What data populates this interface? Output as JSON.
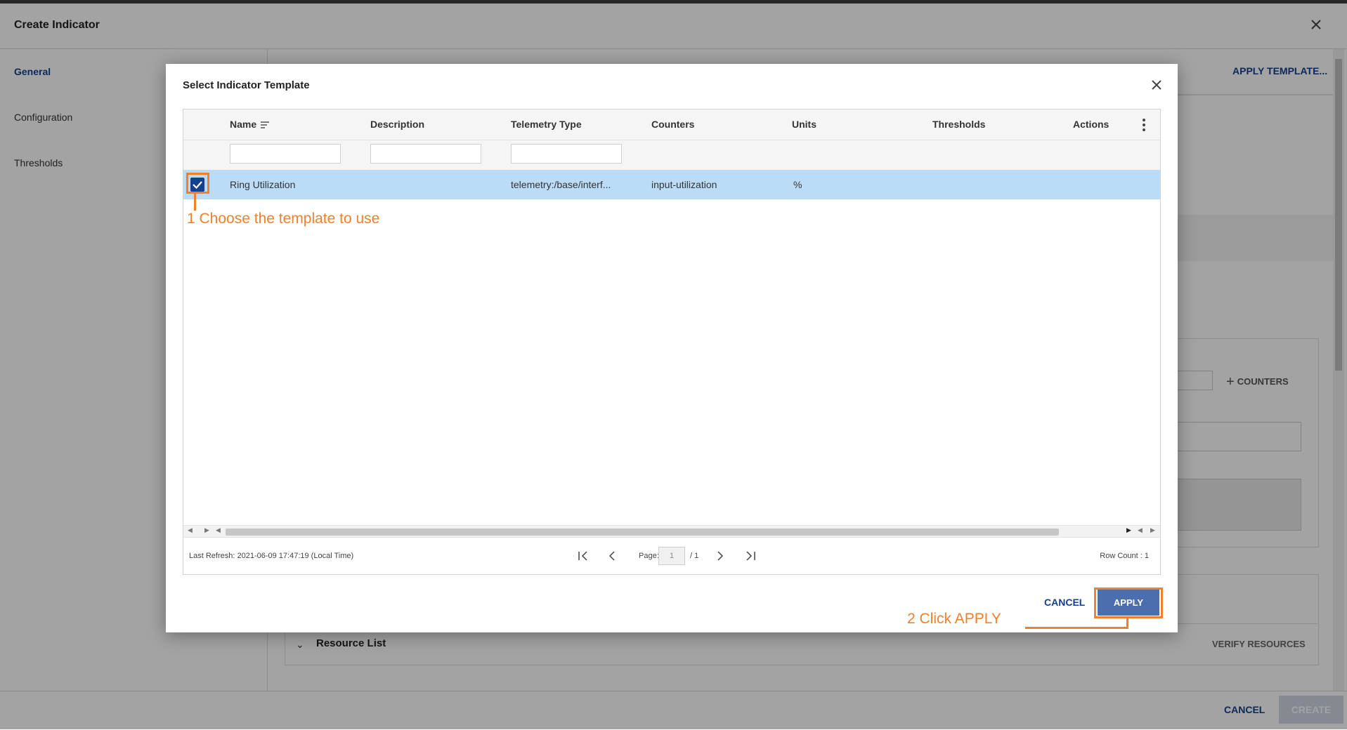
{
  "page": {
    "title": "Create Indicator",
    "nav": [
      "General",
      "Configuration",
      "Thresholds"
    ],
    "apply_template_link": "APPLY TEMPLATE...",
    "counters_button": "COUNTERS",
    "resource_list_label": "Resource List",
    "verify_resources_button": "VERIFY RESOURCES",
    "footer": {
      "cancel": "CANCEL",
      "create": "CREATE"
    }
  },
  "modal": {
    "title": "Select Indicator Template",
    "columns": [
      "Name",
      "Description",
      "Telemetry Type",
      "Counters",
      "Units",
      "Thresholds",
      "Actions"
    ],
    "rows": [
      {
        "checked": true,
        "name": "Ring Utilization",
        "description": "",
        "telemetry_type": "telemetry:/base/interf...",
        "counters": "input-utilization",
        "units": "%",
        "thresholds": ""
      }
    ],
    "footer": {
      "last_refresh": "Last Refresh: 2021-06-09 17:47:19 (Local Time)",
      "page_label": "Page:",
      "page_value": "1",
      "page_total": "/ 1",
      "row_count": "Row Count : 1"
    },
    "buttons": {
      "cancel": "CANCEL",
      "apply": "APPLY"
    }
  },
  "annotations": {
    "step1": "1 Choose the template to use",
    "step2": "2 Click APPLY",
    "color": "#f37f2a"
  },
  "colors": {
    "accent": "#14408f",
    "apply_button": "#4b6eaf",
    "selected_row": "#bbdcf7"
  }
}
